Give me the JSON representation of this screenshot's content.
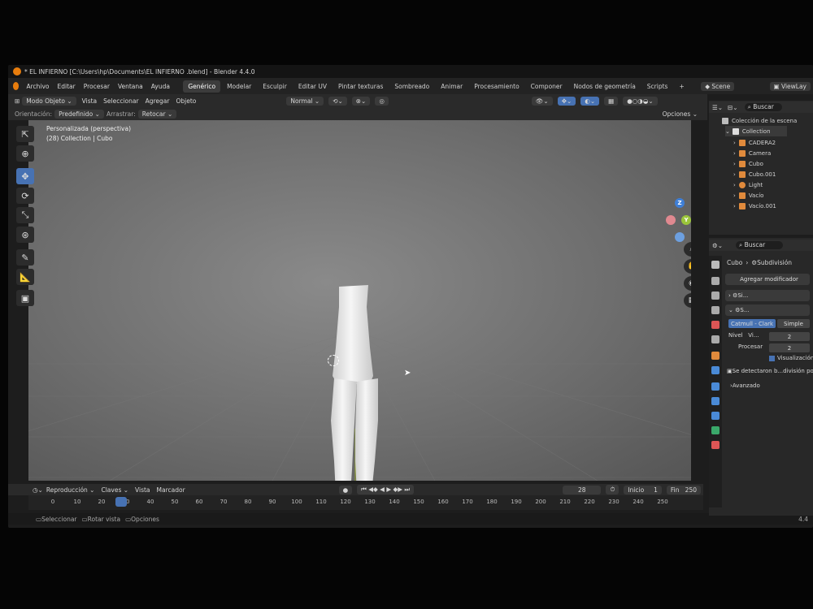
{
  "window": {
    "title": "* EL INFIERNO  [C:\\Users\\hp\\Documents\\EL INFIERNO .blend] - Blender 4.4.0"
  },
  "menu": {
    "items": [
      "Archivo",
      "Editar",
      "Procesar",
      "Ventana",
      "Ayuda"
    ]
  },
  "workspaces": {
    "tabs": [
      "Genérico",
      "Modelar",
      "Esculpir",
      "Editar UV",
      "Pintar texturas",
      "Sombreado",
      "Animar",
      "Procesamiento",
      "Componer",
      "Nodos de geometría",
      "Scripts"
    ],
    "active": "Genérico",
    "add": "+"
  },
  "scene": {
    "label": "Scene",
    "viewlayer": "ViewLay"
  },
  "header": {
    "mode": "Modo Objeto",
    "menus": [
      "Vista",
      "Seleccionar",
      "Agregar",
      "Objeto"
    ],
    "orientation_label": "Normal",
    "opciones": "Opciones"
  },
  "header2": {
    "orientacion": "Orientación:",
    "predefinido": "Predefinido",
    "arrastrar": "Arrastrar:",
    "retocar": "Retocar"
  },
  "viewport": {
    "view_name": "Personalizada (perspectiva)",
    "collection_info": "(28) Collection | Cubo"
  },
  "gizmo": {
    "z": "Z",
    "x": "X",
    "y": "Y"
  },
  "timeline": {
    "menus": [
      "Reproducción",
      "Claves",
      "Vista",
      "Marcador"
    ],
    "current_frame": "28",
    "inicio_label": "Inicio",
    "inicio_value": "1",
    "fin_label": "Fin",
    "fin_value": "250",
    "ticks": [
      "0",
      "10",
      "20",
      "30",
      "40",
      "50",
      "60",
      "70",
      "80",
      "90",
      "100",
      "110",
      "120",
      "130",
      "140",
      "150",
      "160",
      "170",
      "180",
      "190",
      "200",
      "210",
      "220",
      "230",
      "240",
      "250"
    ]
  },
  "status": {
    "select": "Seleccionar",
    "rotate": "Rotar vista",
    "options": "Opciones",
    "version": "4.4"
  },
  "outliner": {
    "search_placeholder": "Buscar",
    "root": "Colección de la escena",
    "collection": "Collection",
    "items": [
      {
        "name": "CADERA2",
        "icon": "mesh-icon",
        "color": "#e08a3c"
      },
      {
        "name": "Camera",
        "icon": "camera-icon",
        "color": "#e08a3c"
      },
      {
        "name": "Cubo",
        "icon": "mesh-icon",
        "color": "#e08a3c"
      },
      {
        "name": "Cubo.001",
        "icon": "mesh-icon",
        "color": "#e08a3c"
      },
      {
        "name": "Light",
        "icon": "light-icon",
        "color": "#e08a3c"
      },
      {
        "name": "Vacío",
        "icon": "empty-icon",
        "color": "#e08a3c"
      },
      {
        "name": "Vacío.001",
        "icon": "empty-icon",
        "color": "#e08a3c"
      }
    ]
  },
  "properties": {
    "search_placeholder": "Buscar",
    "breadcrumb_object": "Cubo",
    "breadcrumb_modifier": "Subdivisión",
    "add_modifier": "Agregar modificador",
    "mod1_name": "Si...",
    "mod2_name": "S...",
    "catmull": "Catmull - Clark",
    "simple": "Simple",
    "nivel_label": "Nivel",
    "vi_label": "Vi...",
    "nivel_value": "2",
    "procesar_label": "Procesar",
    "procesar_value": "2",
    "visualizacion": "Visualización ...",
    "warning": "Se detectaron b...división por G",
    "avanzado": "Avanzado"
  },
  "colors": {
    "accent": "#4772b3",
    "brand": "#e87d0d"
  }
}
